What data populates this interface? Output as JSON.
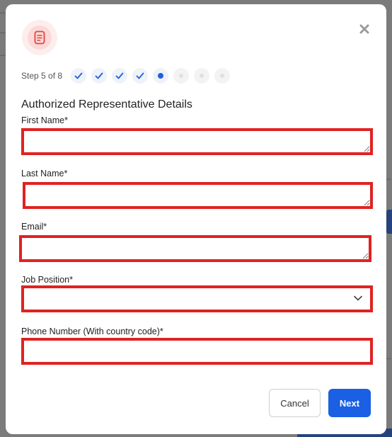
{
  "modal": {
    "icon": "document-icon",
    "close_icon": "close-icon",
    "step_label": "Step 5 of 8",
    "steps": [
      {
        "state": "done"
      },
      {
        "state": "done"
      },
      {
        "state": "done"
      },
      {
        "state": "done"
      },
      {
        "state": "current"
      },
      {
        "state": "pending"
      },
      {
        "state": "pending"
      },
      {
        "state": "pending"
      }
    ],
    "section_title": "Authorized Representative Details",
    "fields": {
      "first_name": {
        "label": "First Name*",
        "value": ""
      },
      "last_name": {
        "label": "Last Name*",
        "value": ""
      },
      "email": {
        "label": "Email*",
        "value": ""
      },
      "job_position": {
        "label": "Job Position*",
        "value": ""
      },
      "phone": {
        "label": "Phone Number (With country code)*",
        "value": ""
      }
    },
    "buttons": {
      "cancel": "Cancel",
      "next": "Next"
    }
  },
  "colors": {
    "highlight_border": "#e02222",
    "primary": "#1a5fe4",
    "badge": "#fbd9d8"
  }
}
